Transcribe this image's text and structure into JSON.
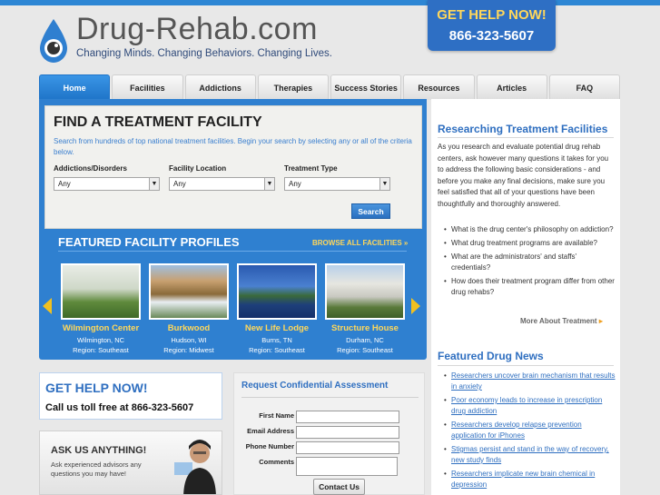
{
  "header": {
    "logo_title": "Drug-Rehab.com",
    "logo_tagline": "Changing Minds. Changing Behaviors. Changing Lives.",
    "help_title": "GET HELP NOW!",
    "help_phone": "866-323-5607"
  },
  "nav": {
    "items": [
      {
        "label": "Home",
        "active": true
      },
      {
        "label": "Facilities"
      },
      {
        "label": "Addictions"
      },
      {
        "label": "Therapies"
      },
      {
        "label": "Success Stories"
      },
      {
        "label": "Resources"
      },
      {
        "label": "Articles"
      },
      {
        "label": "FAQ"
      }
    ]
  },
  "search": {
    "title": "FIND A TREATMENT FACILITY",
    "description": "Search from hundreds of top national treatment facilities.  Begin your search by selecting any or all of the criteria below.",
    "fields": [
      {
        "label": "Addictions/Disorders",
        "value": "Any"
      },
      {
        "label": "Facility Location",
        "value": "Any"
      },
      {
        "label": "Treatment Type",
        "value": "Any"
      }
    ],
    "button": "Search"
  },
  "featured": {
    "title": "FEATURED FACILITY PROFILES",
    "browse": "BROWSE ALL FACILITIES »",
    "facilities": [
      {
        "name": "Wilmington Center",
        "location": "Wilmington, NC",
        "region": "Region:  Southeast"
      },
      {
        "name": "Burkwood",
        "location": "Hudson, WI",
        "region": "Region:  Midwest"
      },
      {
        "name": "New Life Lodge",
        "location": "Burns, TN",
        "region": "Region:  Southeast"
      },
      {
        "name": "Structure House",
        "location": "Durham, NC",
        "region": "Region:  Southeast"
      }
    ]
  },
  "gethelp": {
    "title": "GET HELP NOW!",
    "subtitle": "Call us toll free at 866-323-5607"
  },
  "askus": {
    "title": "ASK US ANYTHING!",
    "text": "Ask experienced advisors any questions you may have!"
  },
  "request": {
    "title": "Request Confidential Assessment",
    "first_name": "First Name",
    "email": "Email Address",
    "phone": "Phone Number",
    "comments": "Comments",
    "button": "Contact Us"
  },
  "sidebar": {
    "research_title": "Researching Treatment Facilities",
    "research_text": "As you research and evaluate potential drug rehab centers, ask however many questions it takes for you to address the following basic considerations - and before you make any final decisions, make sure you feel satisfied that all of your questions have been thoughtfully and thoroughly answered.",
    "questions": [
      "What is the drug center's philosophy on addiction?",
      "What drug treatment programs are available?",
      "What are the administrators' and staffs' credentials?",
      "How does their treatment program differ from other drug rehabs?"
    ],
    "more": "More About Treatment",
    "news_title": "Featured Drug News",
    "news": [
      "Researchers uncover brain mechanism that results in anxiety",
      "Poor economy leads to increase in prescription drug addiction",
      "Researchers develop relapse prevention application for iPhones",
      "Stigmas persist and stand in the way of recovery, new study finds",
      "Researchers implicate new brain chemical in depression"
    ]
  }
}
